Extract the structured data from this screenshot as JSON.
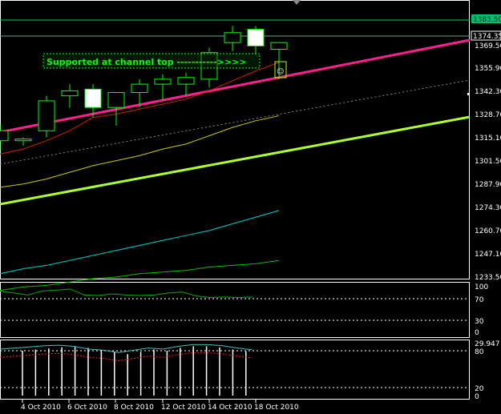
{
  "chart_data": [
    {
      "type": "candlestick",
      "panel": "main",
      "y_ticks": [
        "1369.50",
        "1355.90",
        "1342.30",
        "1328.70",
        "1315.10",
        "1301.50",
        "1287.90",
        "1274.30",
        "1260.70",
        "1247.10",
        "1233.50"
      ],
      "current_price_label": "1374.35",
      "top_line_label": "1383.50",
      "annotation": "Supported at channel top ----------->>>>",
      "ylim": [
        1233.5,
        1391
      ],
      "candles": [
        {
          "o": 1316,
          "h": 1326,
          "l": 1310,
          "c": 1322
        },
        {
          "o": 1316,
          "h": 1318,
          "l": 1313,
          "c": 1317
        },
        {
          "o": 1322,
          "h": 1343,
          "l": 1318,
          "c": 1340
        },
        {
          "o": 1343,
          "h": 1350,
          "l": 1336,
          "c": 1346
        },
        {
          "o": 1347,
          "h": 1350,
          "l": 1330,
          "c": 1336
        },
        {
          "o": 1336,
          "h": 1345,
          "l": 1325,
          "c": 1345
        },
        {
          "o": 1345,
          "h": 1353,
          "l": 1336,
          "c": 1350
        },
        {
          "o": 1350,
          "h": 1356,
          "l": 1340,
          "c": 1353
        },
        {
          "o": 1350,
          "h": 1357,
          "l": 1343,
          "c": 1354
        },
        {
          "o": 1353,
          "h": 1372,
          "l": 1348,
          "c": 1369
        },
        {
          "o": 1375,
          "h": 1385,
          "l": 1370,
          "c": 1381
        },
        {
          "o": 1383,
          "h": 1385,
          "l": 1368,
          "c": 1373
        },
        {
          "o": 1371,
          "h": 1375,
          "l": 1353,
          "c": 1375
        }
      ],
      "ma_red": [
        1308,
        1311,
        1316,
        1322,
        1330,
        1332,
        1335,
        1338,
        1341,
        1346,
        1352,
        1358,
        1363
      ],
      "ma_yellow": [
        1288,
        1290,
        1293,
        1297,
        1301,
        1304,
        1307,
        1311,
        1314,
        1319,
        1324,
        1328,
        1331
      ],
      "ma_cyan": [
        1236,
        1239,
        1241,
        1244,
        1247,
        1250,
        1253,
        1256,
        1259,
        1262,
        1266,
        1270,
        1274
      ],
      "ma_green": [
        1226,
        1228,
        1229,
        1231,
        1233,
        1234,
        1236,
        1237,
        1238,
        1240,
        1241,
        1242,
        1244
      ]
    },
    {
      "type": "line",
      "panel": "oscillator_1",
      "y_ticks": [
        "100",
        "70",
        "30",
        "0"
      ],
      "ylim": [
        0,
        100
      ],
      "values": [
        88,
        84,
        80,
        88,
        90,
        92,
        80,
        79,
        82,
        80,
        79,
        80,
        84,
        86,
        78,
        75,
        76,
        75,
        76
      ]
    },
    {
      "type": "bar",
      "panel": "oscillator_2",
      "y_ticks": [
        "80",
        "20",
        "0"
      ],
      "current_value_label": "29.947",
      "ylim": [
        0,
        100
      ],
      "values": [
        80,
        82,
        84,
        86,
        87,
        85,
        80,
        78,
        74,
        78,
        82,
        80,
        85,
        88,
        88,
        86,
        82,
        79
      ]
    }
  ],
  "x_labels": [
    "4 Oct 2010",
    "6 Oct 2010",
    "8 Oct 2010",
    "12 Oct 2010",
    "14 Oct 2010",
    "18 Oct 2010"
  ],
  "colors": {
    "background": "#000000",
    "bull_candle": "#ffffff",
    "candle_outline": "#00ff00",
    "upper_channel": "#ff1f8f",
    "lower_channel": "#adff2f",
    "ma_red": "#cc2200",
    "ma_yellow": "#cccc00",
    "ma_cyan": "#00d0d0",
    "ma_green": "#00c000",
    "panel_border": "#ffffff",
    "top_line": "#00d070",
    "osc_line": "#00b000",
    "osc_cyan": "#40c0c0",
    "osc_red_dotted": "#ff2020"
  }
}
